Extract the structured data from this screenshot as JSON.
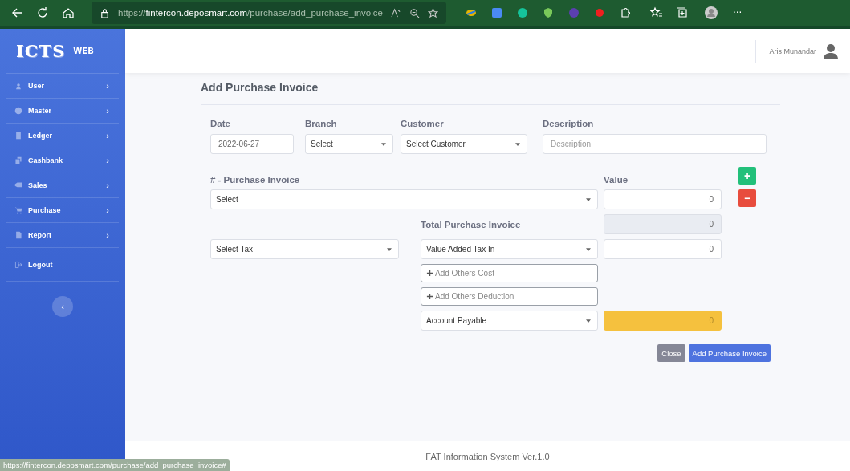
{
  "browser": {
    "url_scheme": "https://",
    "url_host": "fintercon.deposmart.com",
    "url_path": "/purchase/add_purchase_invoice",
    "more": "···"
  },
  "sidebar": {
    "logo": "ICTS",
    "logo_suffix": "WEB",
    "items": [
      {
        "label": "User",
        "chevron": "›"
      },
      {
        "label": "Master",
        "chevron": "›"
      },
      {
        "label": "Ledger",
        "chevron": "›"
      },
      {
        "label": "Cashbank",
        "chevron": "›"
      },
      {
        "label": "Sales",
        "chevron": "›"
      },
      {
        "label": "Purchase",
        "chevron": "›"
      },
      {
        "label": "Report",
        "chevron": "›"
      }
    ],
    "logout": "Logout",
    "collapse": "‹"
  },
  "topbar": {
    "user": "Aris Munandar"
  },
  "form": {
    "title": "Add Purchase Invoice",
    "fields": [
      {
        "label": "Date",
        "kind": "input",
        "value": "2022-06-27"
      },
      {
        "label": "Branch",
        "kind": "select",
        "value": "Select"
      },
      {
        "label": "Customer",
        "kind": "select",
        "value": "Select Customer"
      },
      {
        "label": "Description",
        "kind": "input",
        "placeholder": "Description"
      }
    ],
    "invoice_label": "# - Purchase Invoice",
    "value_label": "Value",
    "invoice_select": "Select",
    "invoice_value": "0",
    "add_row": "+",
    "remove_row": "−",
    "total_label": "Total Purchase Invoice",
    "total_value": "0",
    "tax_select": "Select Tax",
    "tax_account": "Value Added Tax In",
    "tax_value": "0",
    "others_cost": "Add Others Cost",
    "others_deduction": "Add Others Deduction",
    "payable_account": "Account Payable",
    "payable_value": "0",
    "buttons": [
      "Close",
      "Add Purchase Invoice"
    ]
  },
  "footer": "FAT Information System Ver.1.0",
  "status_url": "https://fintercon.deposmart.com/purchase/add_purchase_invoice#"
}
